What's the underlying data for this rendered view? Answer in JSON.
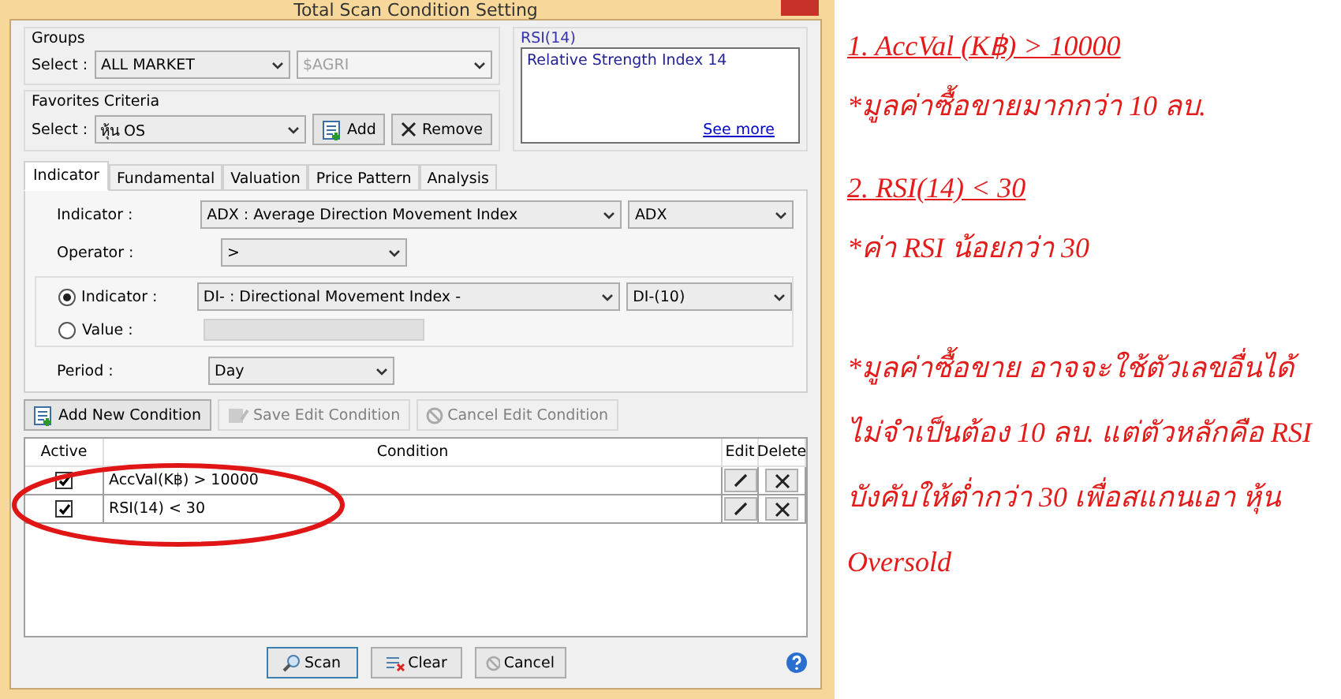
{
  "window": {
    "title": "Total Scan Condition Setting"
  },
  "groups": {
    "label": "Groups",
    "select_label": "Select :",
    "value": "ALL MARKET",
    "secondary_value": "$AGRI"
  },
  "favorites": {
    "label": "Favorites Criteria",
    "select_label": "Select :",
    "value": "หุ้น OS",
    "buttons": [
      {
        "label": "Add",
        "kind": "add"
      },
      {
        "label": "Remove",
        "kind": "remove"
      }
    ]
  },
  "description": {
    "title": "RSI(14)",
    "text": "Relative Strength Index 14",
    "link": "See more"
  },
  "tabs": [
    {
      "label": "Indicator",
      "selected": true
    },
    {
      "label": "Fundamental",
      "selected": false
    },
    {
      "label": "Valuation",
      "selected": false
    },
    {
      "label": "Price Pattern",
      "selected": false
    },
    {
      "label": "Analysis",
      "selected": false
    }
  ],
  "form": {
    "indicator_label": "Indicator :",
    "indicator": "ADX : Average Direction Movement Index",
    "indicator_sub": "ADX",
    "operator_label": "Operator :",
    "operator": ">",
    "period_label": "Period :",
    "period": "Day",
    "compare": [
      {
        "label": "Indicator :",
        "selected": true,
        "value": "DI- : Directional Movement Index -",
        "sub": "DI-(10)"
      },
      {
        "label": "Value :",
        "selected": false
      }
    ]
  },
  "condition_buttons": [
    {
      "label": "Add New Condition",
      "kind": "add",
      "disabled": false
    },
    {
      "label": "Save Edit Condition",
      "kind": "save",
      "disabled": true
    },
    {
      "label": "Cancel Edit Condition",
      "kind": "cancel",
      "disabled": true
    }
  ],
  "table": {
    "columns": [
      "Active",
      "Condition",
      "Edit",
      "Delete"
    ],
    "rows": [
      {
        "active": true,
        "condition": "AccVal(K฿) > 10000"
      },
      {
        "active": true,
        "condition": "RSI(14) < 30"
      }
    ]
  },
  "footer_buttons": [
    {
      "label": "Scan",
      "kind": "scan"
    },
    {
      "label": "Clear",
      "kind": "clear"
    },
    {
      "label": "Cancel",
      "kind": "cancel"
    }
  ],
  "annotations": [
    {
      "kind": "heading",
      "text": "1. AccVal (K฿) > 10000"
    },
    {
      "kind": "note",
      "text": "*มูลค่าซื้อขายมากกว่า 10 ลบ."
    },
    {
      "kind": "heading",
      "text": "2. RSI(14) < 30"
    },
    {
      "kind": "note",
      "text": "*ค่า RSI น้อยกว่า 30"
    },
    {
      "kind": "paragraph",
      "text": "*มูลค่าซื้อขาย อาจจะใช้ตัวเลขอื่นได้ ไม่จำเป็นต้อง 10 ลบ. แต่ตัวหลักคือ RSI บังคับให้ต่ำกว่า 30 เพื่อสแกนเอา หุ้น Oversold"
    }
  ]
}
